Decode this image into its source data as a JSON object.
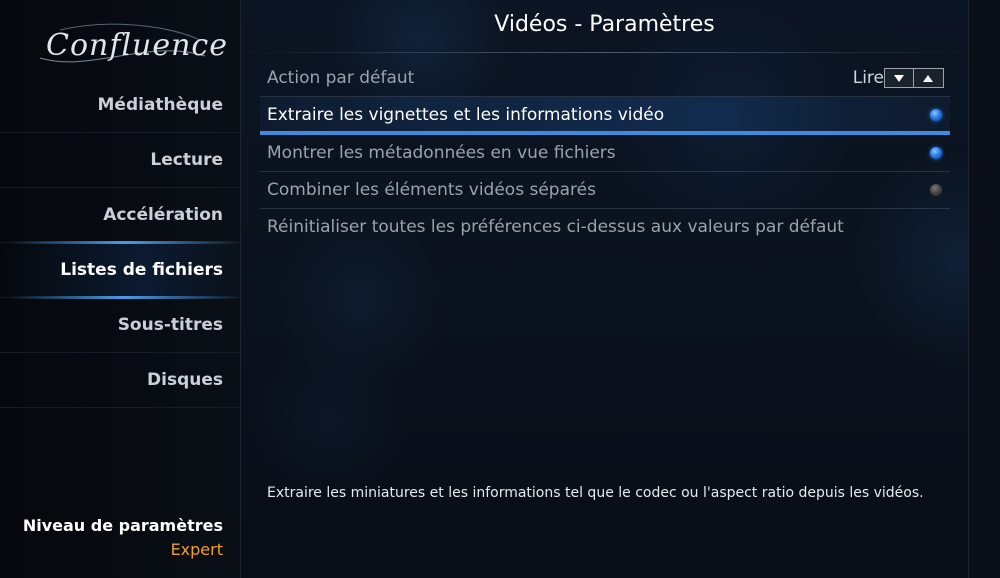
{
  "app": {
    "logo": "Confluence"
  },
  "title": "Vidéos - Paramètres",
  "sidebar": {
    "items": [
      {
        "label": "Médiathèque",
        "active": false
      },
      {
        "label": "Lecture",
        "active": false
      },
      {
        "label": "Accélération",
        "active": false
      },
      {
        "label": "Listes de fichiers",
        "active": true
      },
      {
        "label": "Sous-titres",
        "active": false
      },
      {
        "label": "Disques",
        "active": false
      }
    ],
    "level_label": "Niveau de paramètres",
    "level_value": "Expert"
  },
  "settings": [
    {
      "label": "Action par défaut",
      "type": "spinner",
      "value": "Lire",
      "icons": [
        "arrow-down-icon",
        "arrow-up-icon"
      ]
    },
    {
      "label": "Extraire les vignettes et les informations vidéo",
      "type": "toggle",
      "on": true,
      "focused": true
    },
    {
      "label": "Montrer les métadonnées en vue fichiers",
      "type": "toggle",
      "on": true
    },
    {
      "label": "Combiner les éléments vidéos séparés",
      "type": "toggle",
      "on": false
    },
    {
      "label": "Réinitialiser toutes les préférences ci-dessus aux valeurs par défaut",
      "type": "action"
    }
  ],
  "help_text": "Extraire les miniatures et les informations tel que le codec ou l'aspect ratio depuis les vidéos.",
  "colors": {
    "accent": "#2a7dea",
    "level_value": "#f0a020"
  }
}
